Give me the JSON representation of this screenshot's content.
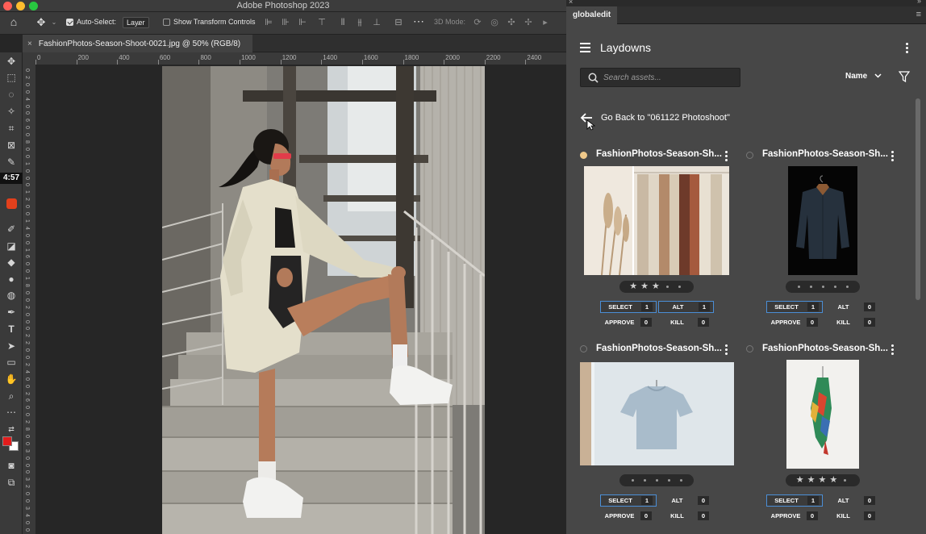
{
  "window": {
    "title": "Adobe Photoshop 2023"
  },
  "options_bar": {
    "auto_select_label": "Auto-Select:",
    "auto_select_value": "Layer",
    "show_transform_label": "Show Transform Controls",
    "mode_3d_label": "3D Mode:"
  },
  "document_tab": {
    "title": "FashionPhotos-Season-Shoot-0021.jpg @ 50% (RGB/8)"
  },
  "ruler": {
    "labels": [
      "0",
      "200",
      "400",
      "600",
      "800",
      "1000",
      "1200",
      "1400",
      "1600",
      "1800",
      "2000",
      "2200",
      "2400"
    ]
  },
  "ruler_left": {
    "labels": [
      "0",
      "2",
      "0",
      "0",
      "4",
      "0",
      "0",
      "6",
      "0",
      "0",
      "8",
      "0",
      "0",
      "1",
      "0",
      "0",
      "0",
      "1",
      "2",
      "0",
      "0",
      "1",
      "4",
      "0",
      "0",
      "1",
      "6",
      "0",
      "0",
      "1",
      "8",
      "0",
      "0",
      "2",
      "0",
      "0",
      "0",
      "2",
      "2",
      "0",
      "0",
      "2",
      "4",
      "0",
      "0",
      "2",
      "6",
      "0",
      "0",
      "2",
      "8",
      "0",
      "0",
      "3",
      "0",
      "0",
      "0",
      "3",
      "2",
      "0",
      "0",
      "3",
      "4",
      "0",
      "0"
    ]
  },
  "toolbar": {
    "timer": "4:57"
  },
  "plugin": {
    "tab_label": "globaledit",
    "title": "Laydowns",
    "search_placeholder": "Search assets...",
    "sort_label": "Name",
    "back_label": "Go Back to \"061122 Photoshoot\""
  },
  "assets": [
    {
      "name": "FashionPhotos-Season-Sh...",
      "picked": true,
      "rating": 3,
      "select": "1",
      "alt": "1",
      "approve": "0",
      "kill": "0",
      "select_on": true,
      "alt_on": true
    },
    {
      "name": "FashionPhotos-Season-Sh...",
      "picked": false,
      "rating": 0,
      "select": "1",
      "alt": "0",
      "approve": "0",
      "kill": "0",
      "select_on": true,
      "alt_on": false
    },
    {
      "name": "FashionPhotos-Season-Sh...",
      "picked": false,
      "rating": 0,
      "select": "1",
      "alt": "0",
      "approve": "0",
      "kill": "0",
      "select_on": true,
      "alt_on": false
    },
    {
      "name": "FashionPhotos-Season-Sh...",
      "picked": false,
      "rating": 4,
      "select": "1",
      "alt": "0",
      "approve": "0",
      "kill": "0",
      "select_on": true,
      "alt_on": false
    }
  ],
  "labels": {
    "select": "SELECT",
    "alt": "ALT",
    "approve": "APPROVE",
    "kill": "KILL"
  },
  "colors": {
    "foreground": "#e21c1c",
    "background": "#ffffff",
    "accent": "#4b8ed6",
    "picked": "#f0c98a"
  }
}
